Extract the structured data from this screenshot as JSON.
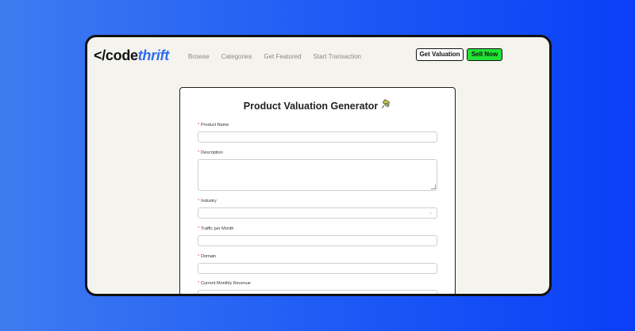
{
  "logo": {
    "bracket": "</",
    "code": "code",
    "thrift": "thrift"
  },
  "nav": {
    "items": [
      "Browse",
      "Categories",
      "Get Featured",
      "Start Transaction"
    ]
  },
  "buttons": {
    "get_valuation": "Get Valuation",
    "sell_now": "Sell Now"
  },
  "form": {
    "title": "Product Valuation Generator",
    "title_icon": "pin-icon",
    "required_marker": "*",
    "fields": [
      {
        "label": "Product Name",
        "type": "text",
        "value": ""
      },
      {
        "label": "Description",
        "type": "textarea",
        "value": ""
      },
      {
        "label": "Industry",
        "type": "select",
        "value": ""
      },
      {
        "label": "Traffic per Month",
        "type": "text",
        "value": ""
      },
      {
        "label": "Domain",
        "type": "text",
        "value": ""
      },
      {
        "label": "Current Monthly Revenue",
        "type": "text",
        "value": ""
      }
    ]
  },
  "colors": {
    "accent_blue": "#2f6cf0",
    "sell_green": "#22e336",
    "required_red": "#e23b3b"
  }
}
